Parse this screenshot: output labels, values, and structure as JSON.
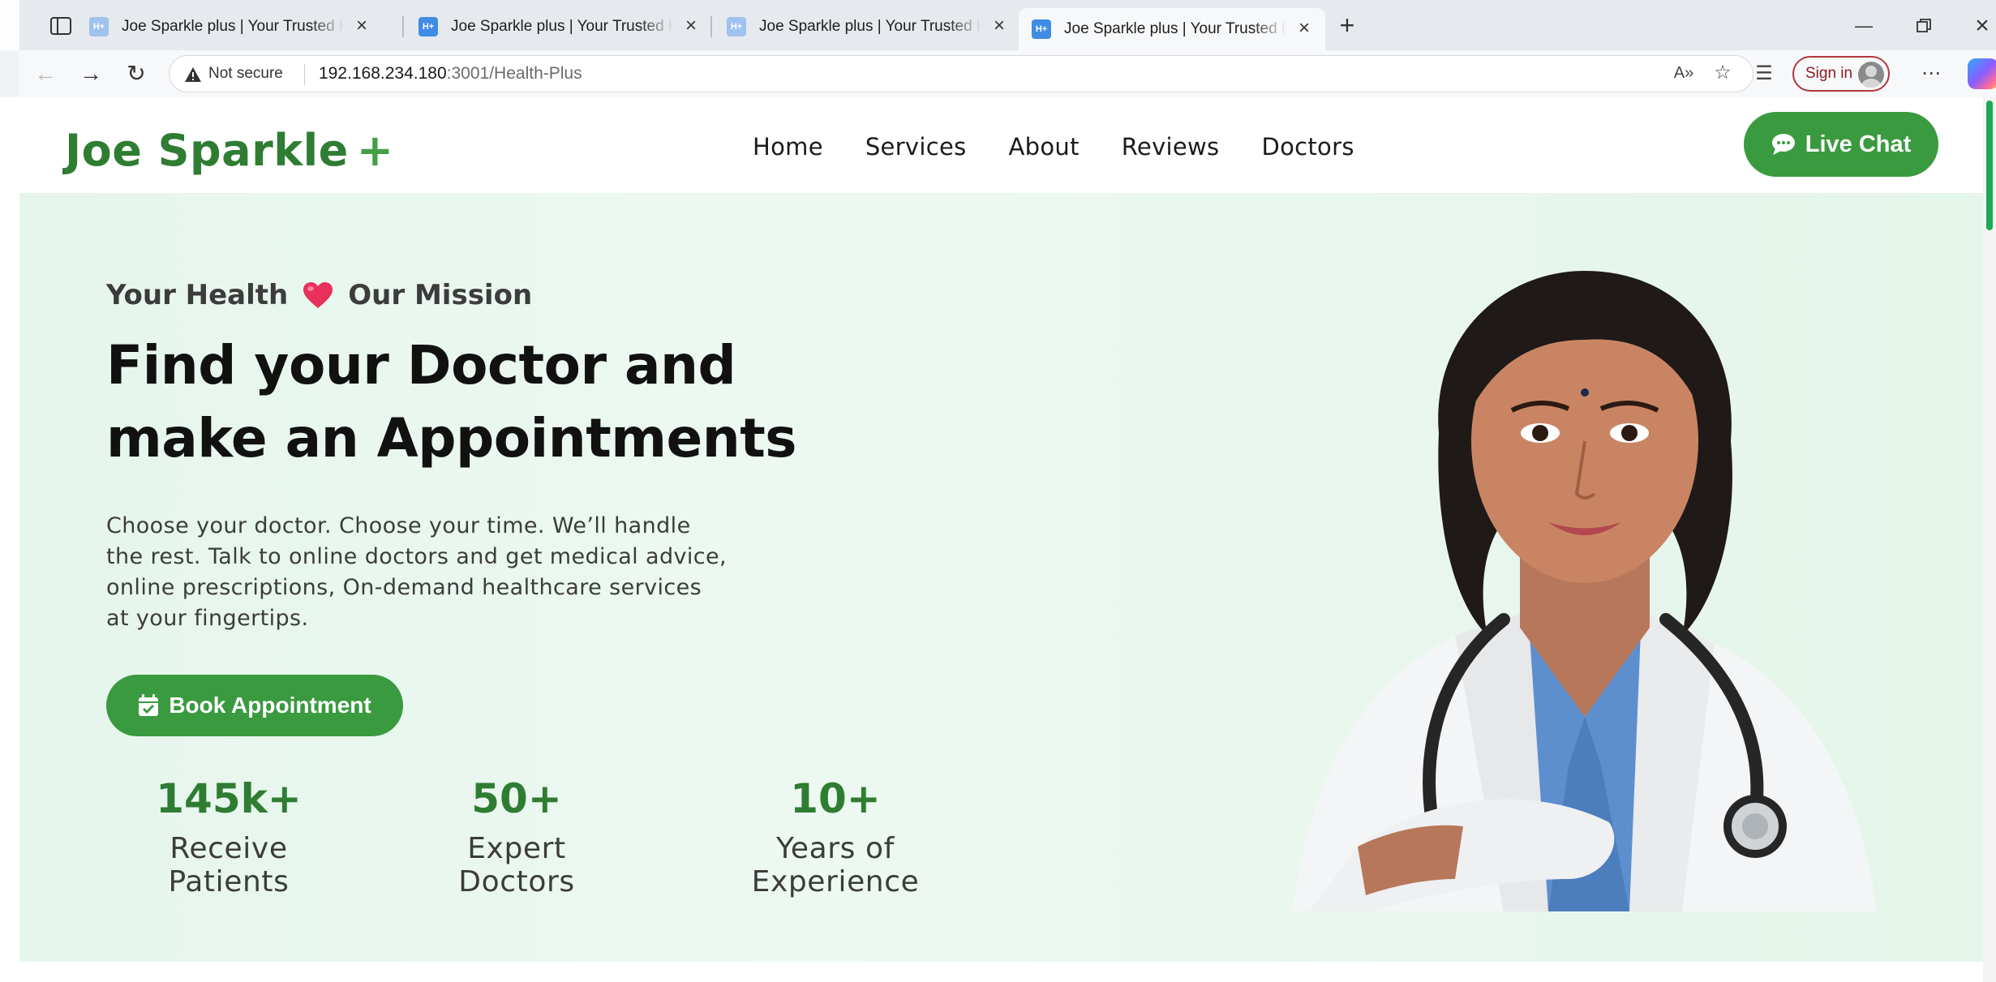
{
  "browser": {
    "tabs": [
      {
        "favicon": "H+",
        "title": "Joe Sparkle plus | Your Trusted Health Partner",
        "active": false
      },
      {
        "favicon": "H+",
        "title": "Joe Sparkle plus | Your Trusted Health Partner",
        "active": false
      },
      {
        "favicon": "H+",
        "title": "Joe Sparkle plus | Your Trusted Health Partner",
        "active": false
      },
      {
        "favicon": "H+",
        "title": "Joe Sparkle plus | Your Trusted Health Partner",
        "active": true
      }
    ],
    "not_secure": "Not secure",
    "url_host": "192.168.234.180",
    "url_rest": ":3001/Health-Plus",
    "signin": "Sign in"
  },
  "site": {
    "logo": "Joe Sparkle",
    "logo_plus": "+",
    "nav": [
      "Home",
      "Services",
      "About",
      "Reviews",
      "Doctors"
    ],
    "live_chat": "Live Chat",
    "hero": {
      "tagline_left": "Your Health",
      "tagline_right": "Our Mission",
      "headline_line1": "Find your Doctor and",
      "headline_line2": "make an Appointments",
      "lead": "Choose your doctor. Choose your time. We’ll handle the rest. Talk to online doctors and get medical advice, online prescriptions, On-demand healthcare services at your fingertips.",
      "book_button": "Book Appointment",
      "stats": [
        {
          "value": "145k+",
          "label": "Receive Patients"
        },
        {
          "value": "50+",
          "label": "Expert Doctors"
        },
        {
          "value": "10+",
          "label": "Years of Experience"
        }
      ]
    }
  },
  "colors": {
    "brand_green": "#2e7d32",
    "button_green": "#3a9a3f",
    "hero_background": "#e6f6ec",
    "heart": "#e8305a"
  }
}
